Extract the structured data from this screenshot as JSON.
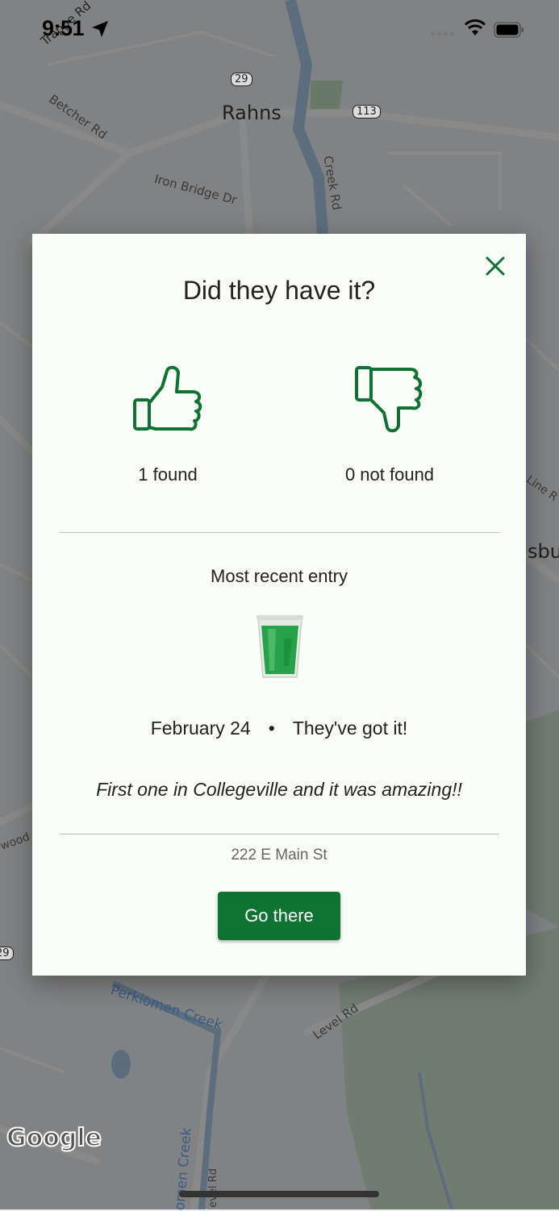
{
  "status_bar": {
    "time": "9:51"
  },
  "map": {
    "place_labels": [
      "Rahns"
    ],
    "road_labels": [
      "Betcher Rd",
      "Iron Bridge Dr",
      "Creek Rd",
      "Perkiomen Creek",
      "Level Rd",
      "omen Creek",
      "evel Rd",
      "Line R",
      "sbu",
      "wood",
      "Trappe Rd"
    ],
    "route_shields": [
      "29",
      "113",
      "29"
    ],
    "attribution": "Google"
  },
  "modal": {
    "title": "Did they have it?",
    "found_label": "1 found",
    "not_found_label": "0 not found",
    "recent_heading": "Most recent entry",
    "entry_date": "February 24",
    "entry_separator": "•",
    "entry_status": "They've got it!",
    "entry_comment": "First one in Collegeville and it was amazing!!",
    "address": "222 E Main St",
    "go_button": "Go there",
    "accent_color": "#0e7233"
  }
}
